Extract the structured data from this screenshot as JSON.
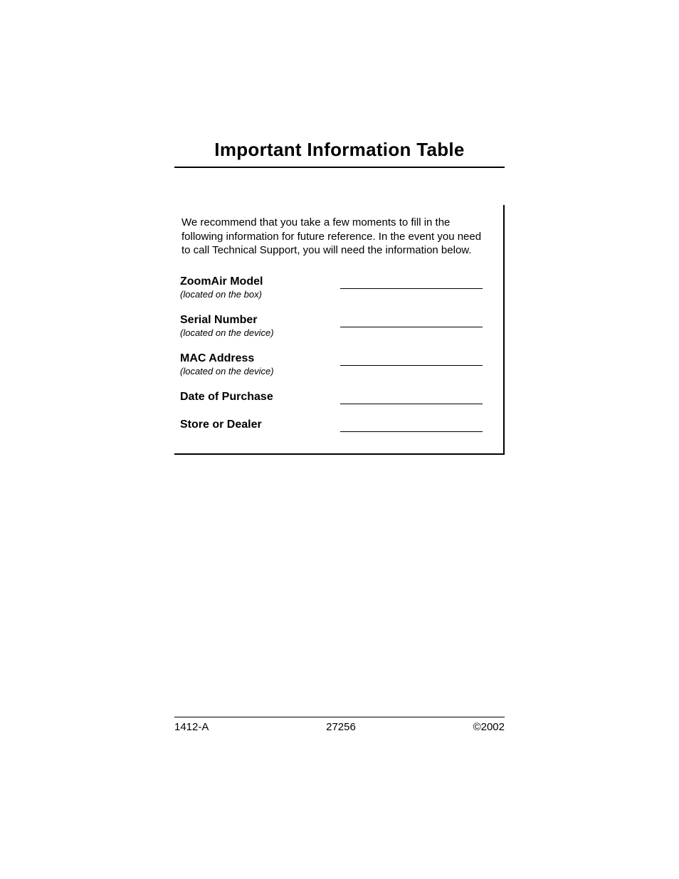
{
  "title": "Important Information Table",
  "intro": "We recommend that you take a few moments to fill in the following information for future reference. In the event you need to call Technical Support, you will need the information below.",
  "fields": [
    {
      "label": "ZoomAir Model",
      "hint": "(located on the box)"
    },
    {
      "label": "Serial Number",
      "hint": "(located on the device)"
    },
    {
      "label": "MAC Address",
      "hint": "(located on the device)"
    },
    {
      "label": "Date of Purchase",
      "hint": ""
    },
    {
      "label": "Store or Dealer",
      "hint": ""
    }
  ],
  "footer": {
    "left": "1412-A",
    "center": "27256",
    "right": "©2002"
  }
}
